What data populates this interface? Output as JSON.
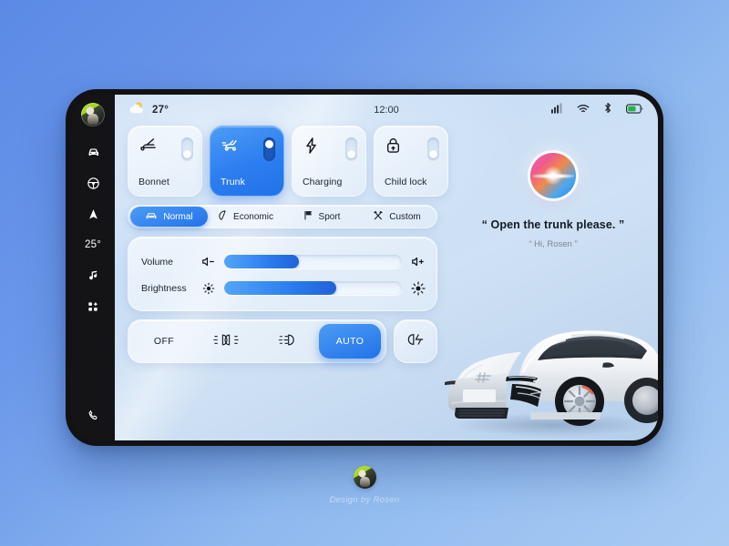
{
  "device": {
    "rail": {
      "avatar_name": "user-avatar",
      "items": [
        {
          "id": "car",
          "icon": "car-icon",
          "label": ""
        },
        {
          "id": "driving",
          "icon": "steering-wheel-icon",
          "label": ""
        },
        {
          "id": "nav",
          "icon": "navigation-arrow-icon",
          "label": ""
        },
        {
          "id": "climate",
          "icon": "temperature-text",
          "label": "25°"
        },
        {
          "id": "music",
          "icon": "music-note-icon",
          "label": ""
        },
        {
          "id": "apps",
          "icon": "grid-apps-icon",
          "label": ""
        },
        {
          "id": "phone",
          "icon": "phone-icon",
          "label": ""
        }
      ]
    },
    "statusbar": {
      "weather_icon": "sun-behind-cloud-icon",
      "temperature": "27°",
      "clock": "12:00",
      "icons": [
        "signal-bars-icon",
        "wifi-icon",
        "bluetooth-icon",
        "battery-icon"
      ]
    },
    "toggles": [
      {
        "label": "Bonnet",
        "icon": "bonnet-open-icon",
        "state": "off"
      },
      {
        "label": "Trunk",
        "icon": "trunk-open-icon",
        "state": "on"
      },
      {
        "label": "Charging",
        "icon": "charging-bolt-icon",
        "state": "off"
      },
      {
        "label": "Child lock",
        "icon": "child-lock-icon",
        "state": "off"
      }
    ],
    "modes": [
      {
        "label": "Normal",
        "icon": "car-icon",
        "active": true
      },
      {
        "label": "Economic",
        "icon": "leaf-icon",
        "active": false
      },
      {
        "label": "Sport",
        "icon": "flag-icon",
        "active": false
      },
      {
        "label": "Custom",
        "icon": "tools-icon",
        "active": false
      }
    ],
    "sliders": [
      {
        "label": "Volume",
        "icon_min": "volume-minus-icon",
        "icon_max": "volume-plus-icon",
        "value": 42
      },
      {
        "label": "Brightness",
        "icon_min": "brightness-low-icon",
        "icon_max": "brightness-high-icon",
        "value": 63
      }
    ],
    "lights": {
      "buttons": [
        {
          "label": "OFF",
          "icon": "",
          "active": false
        },
        {
          "label": "",
          "icon": "position-lights-icon",
          "active": false
        },
        {
          "label": "",
          "icon": "low-beam-icon",
          "active": false
        },
        {
          "label": "AUTO",
          "icon": "",
          "active": true
        }
      ],
      "fog": {
        "label": "",
        "icon": "fog-light-icon"
      }
    },
    "assistant": {
      "orb": "siri-orb",
      "message": "“ Open the trunk please. ”",
      "reply": "“ Hi, Rosen ”"
    },
    "car_image": "white-electric-sedan"
  },
  "footer": {
    "avatar": "designer-avatar",
    "credit": "Design by Rosen"
  },
  "colors": {
    "accent": "#2272e8",
    "accent_light": "#4c9cf5",
    "background_from": "#5b8ae6",
    "background_to": "#a8cbf3",
    "rail_bg": "#141416",
    "text_dark": "#1b222c",
    "text_muted": "#7b8594"
  }
}
